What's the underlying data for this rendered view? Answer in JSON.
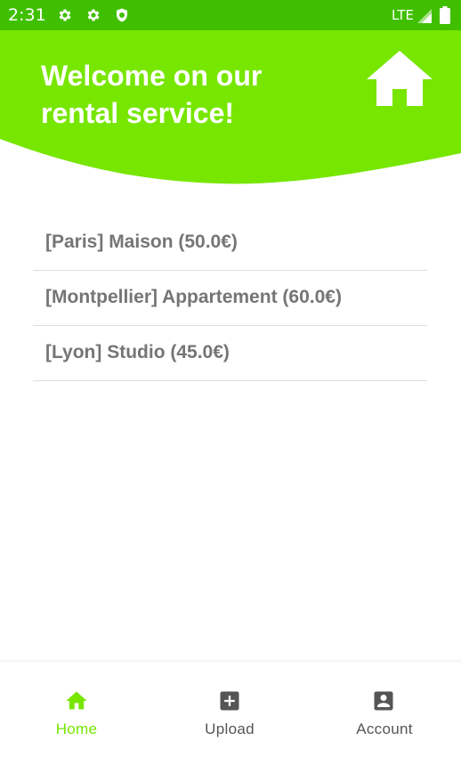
{
  "status_bar": {
    "time": "2:31",
    "network": "LTE",
    "icons": [
      "gear-icon",
      "gear-icon",
      "shield-icon",
      "signal-icon",
      "battery-icon"
    ]
  },
  "header": {
    "title": "Welcome on our rental service!",
    "logo_icon": "house-icon"
  },
  "rentals": [
    {
      "label": "[Paris] Maison (50.0€)"
    },
    {
      "label": "[Montpellier] Appartement (60.0€)"
    },
    {
      "label": "[Lyon] Studio (45.0€)"
    }
  ],
  "bottom_nav": {
    "items": [
      {
        "label": "Home",
        "icon": "home-icon",
        "selected": true
      },
      {
        "label": "Upload",
        "icon": "add-box-icon",
        "selected": false
      },
      {
        "label": "Account",
        "icon": "account-box-icon",
        "selected": false
      }
    ]
  },
  "colors": {
    "status_bar": "#3fbf00",
    "header": "#77e600",
    "accent": "#77e600",
    "list_text": "#757575",
    "nav_inactive": "#555555"
  }
}
